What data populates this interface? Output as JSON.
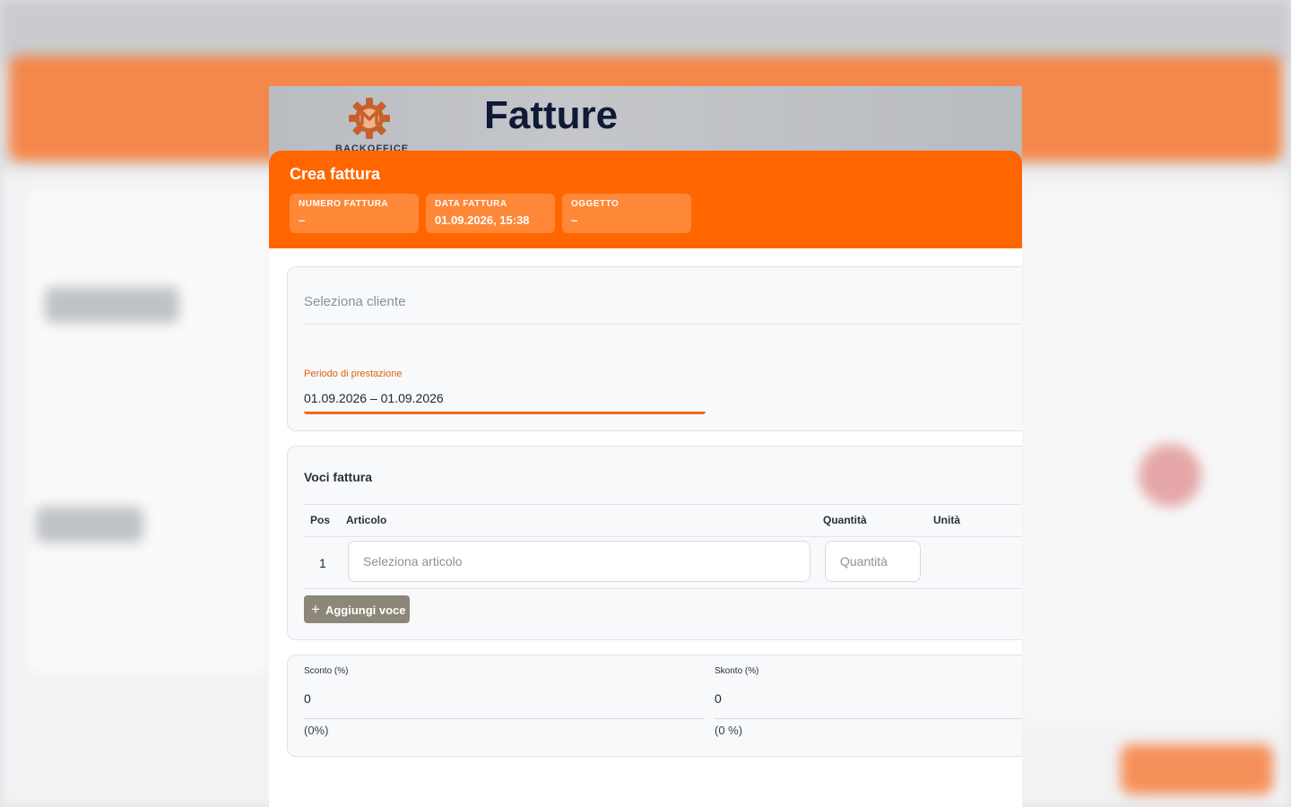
{
  "page": {
    "title": "Fatture",
    "brand": "BACKOFFICE"
  },
  "modal": {
    "title": "Crea fattura",
    "info": [
      {
        "label": "NUMERO FATTURA",
        "value": "–"
      },
      {
        "label": "DATA FATTURA",
        "value": "01.09.2026, 15:38"
      },
      {
        "label": "OGGETTO",
        "value": "–"
      }
    ]
  },
  "client": {
    "placeholder": "Seleziona cliente",
    "period_label": "Periodo di prestazione",
    "period_value": "01.09.2026 – 01.09.2026"
  },
  "items": {
    "title": "Voci fattura",
    "columns": {
      "pos": "Pos",
      "article": "Articolo",
      "quantity": "Quantità",
      "unit": "Unità"
    },
    "rows": [
      {
        "pos": "1",
        "article_placeholder": "Seleziona articolo",
        "quantity_placeholder": "Quantità"
      }
    ],
    "add_label": "Aggiungi voce"
  },
  "discounts": [
    {
      "label": "Sconto (%)",
      "value": "0",
      "pct": "(0%)"
    },
    {
      "label": "Skonto (%)",
      "value": "0",
      "pct": "(0 %)"
    }
  ],
  "colors": {
    "accent": "#ff6600",
    "title": "#101a35",
    "button": "#8c8779"
  }
}
